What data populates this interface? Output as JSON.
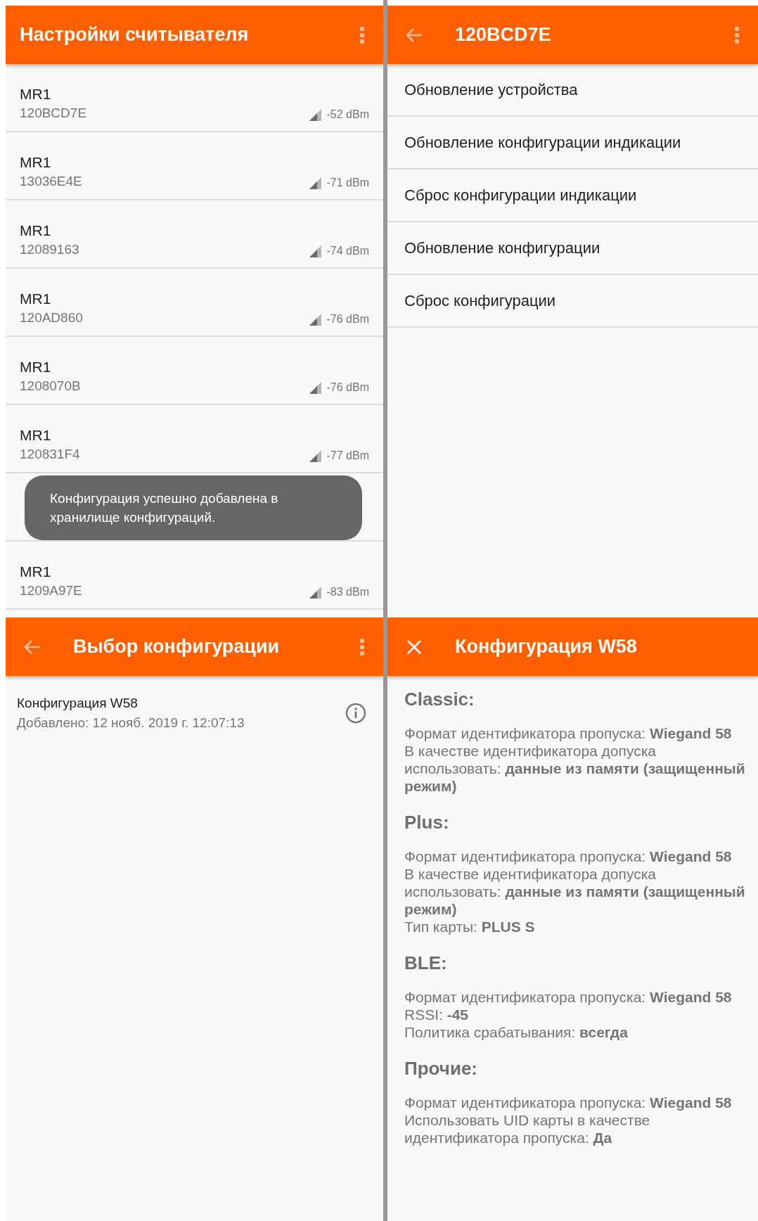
{
  "reader_settings": {
    "title": "Настройки считывателя",
    "rows": [
      {
        "model": "MR1",
        "id": "120BCD7E",
        "rssi": "-52 dBm"
      },
      {
        "model": "MR1",
        "id": "13036E4E",
        "rssi": "-71 dBm"
      },
      {
        "model": "MR1",
        "id": "12089163",
        "rssi": "-74 dBm"
      },
      {
        "model": "MR1",
        "id": "120AD860",
        "rssi": "-76 dBm"
      },
      {
        "model": "MR1",
        "id": "1208070B",
        "rssi": "-76 dBm"
      },
      {
        "model": "MR1",
        "id": "120831F4",
        "rssi": "-77 dBm"
      },
      {},
      {
        "model": "MR1",
        "id": "1209A97E",
        "rssi": "-83 dBm"
      }
    ],
    "toast": "Конфигурация успешно добавлена в хранилище конфигураций."
  },
  "device_menu": {
    "title": "120BCD7E",
    "items": [
      "Обновление устройства",
      "Обновление конфигурации индикации",
      "Сброс конфигурации индикации",
      "Обновление конфигурации",
      "Сброс конфигурации"
    ]
  },
  "config_select": {
    "title": "Выбор конфигурации",
    "items": [
      {
        "name": "Конфигурация W58",
        "added": "Добавлено: 12 нояб. 2019 г. 12:07:13"
      }
    ]
  },
  "config_details": {
    "title": "Конфигурация W58",
    "sections": [
      {
        "heading": "Classic:",
        "lines": [
          "Формат идентификатора пропуска: **Wiegand 58**",
          "В качестве идентификатора допуска использовать: **данные из памяти (защищенный режим)**"
        ]
      },
      {
        "heading": "Plus:",
        "lines": [
          "Формат идентификатора пропуска: **Wiegand 58**",
          "В качестве идентификатора допуска использовать: **данные из памяти (защищенный режим)**",
          "Тип карты: **PLUS S**"
        ]
      },
      {
        "heading": "BLE:",
        "lines": [
          "Формат идентификатора пропуска: **Wiegand 58**",
          "RSSI: **-45**",
          "Политика срабатывания: **всегда**"
        ]
      },
      {
        "heading": "Прочие:",
        "lines": [
          "Формат идентификатора пропуска: **Wiegand 58**",
          "Использовать UID карты в качестве идентификатора пропуска: **Да**"
        ]
      }
    ]
  }
}
